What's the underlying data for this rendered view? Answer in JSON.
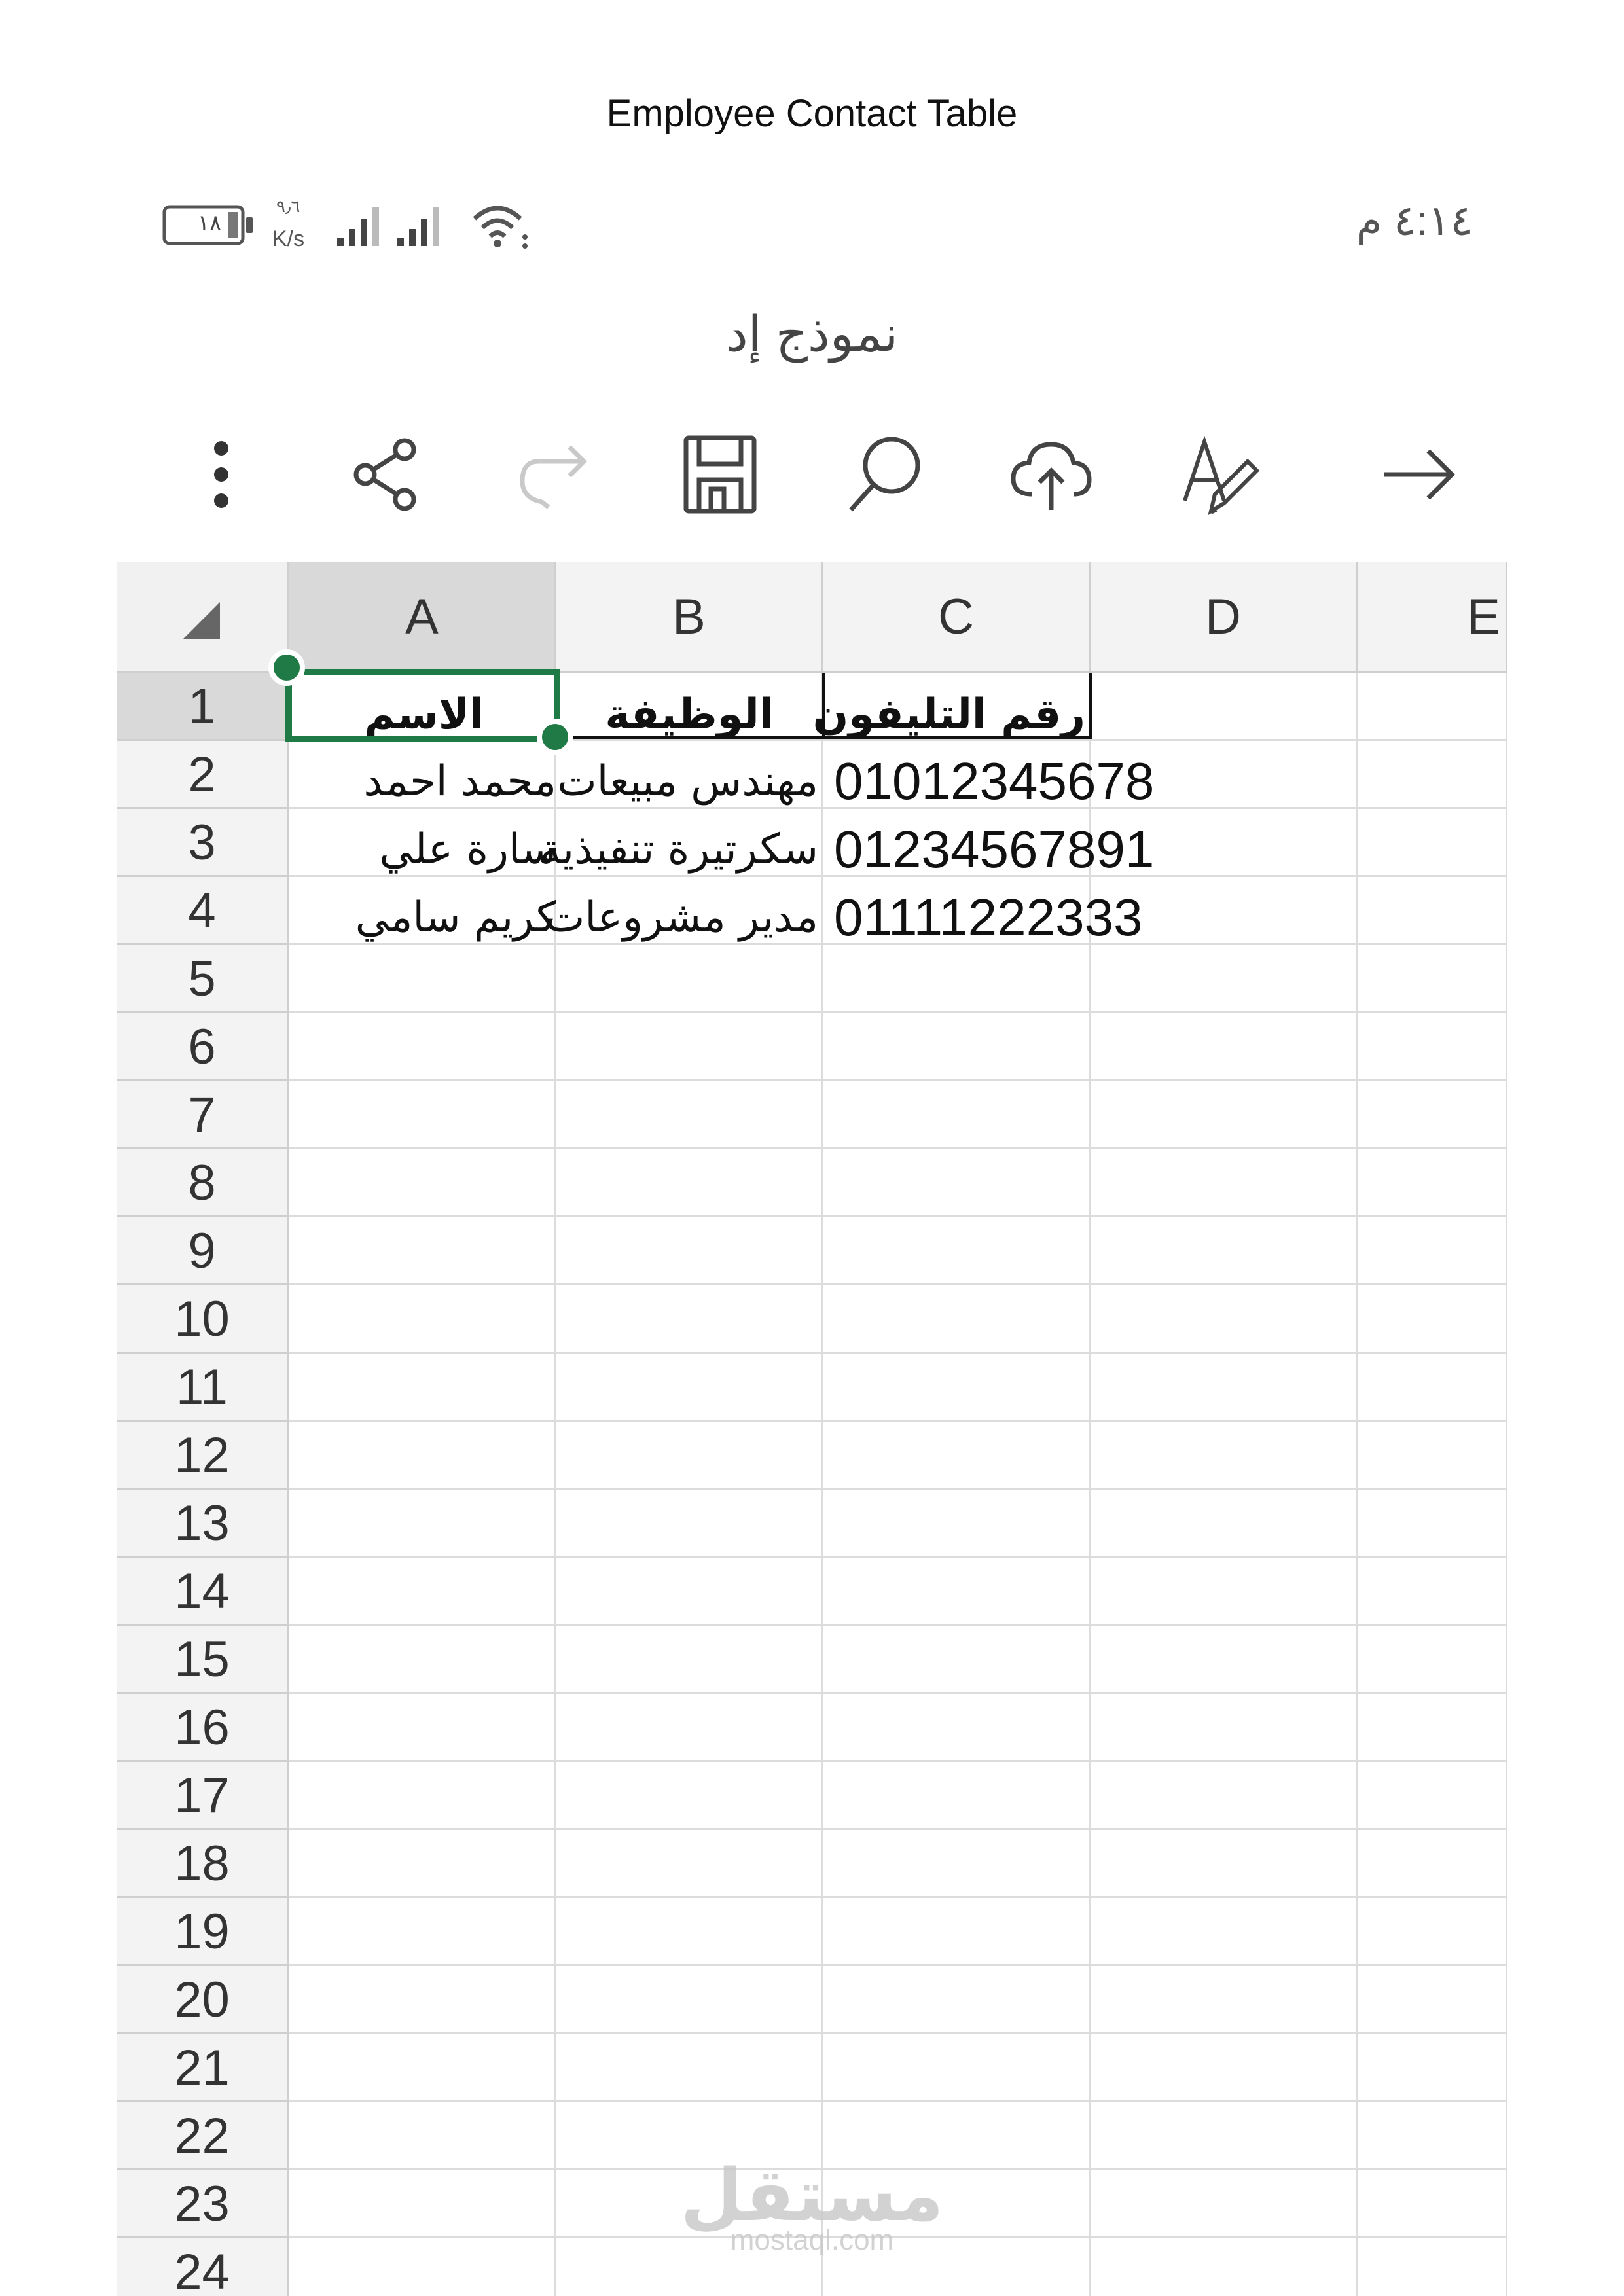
{
  "document_title": "Employee Contact Table",
  "status_bar": {
    "battery": "١٨",
    "speed_value": "٩٫٦",
    "speed_unit": "K/s",
    "time": "٤:١٤ م"
  },
  "workbook_name": "نموذج إد",
  "toolbar": {
    "items": [
      "more-icon",
      "share-icon",
      "redo-icon",
      "save-icon",
      "search-icon",
      "upload-icon",
      "format-icon",
      "arrow-right-icon"
    ]
  },
  "grid": {
    "columns": [
      "A",
      "B",
      "C",
      "D",
      "E"
    ],
    "rows": [
      "1",
      "2",
      "3",
      "4",
      "5",
      "6",
      "7",
      "8",
      "9",
      "10",
      "11",
      "12",
      "13",
      "14",
      "15",
      "16",
      "17",
      "18",
      "19",
      "20",
      "21",
      "22",
      "23",
      "24"
    ],
    "header_row": {
      "a": "الاسم",
      "b": "الوظيفة",
      "c": "رقم التليفون"
    },
    "data_rows": [
      {
        "a": "محمد احمد",
        "b": "مهندس مبيعات",
        "c": "01012345678"
      },
      {
        "a": "سارة علي",
        "b": "سكرتيرة تنفيذية",
        "c": "01234567891"
      },
      {
        "a": "كريم سامي",
        "b": "مدير مشروعات",
        "c": "01111222333"
      }
    ]
  },
  "watermark": {
    "arabic": "مستقل",
    "latin": "mostaql.com"
  },
  "colors": {
    "selection": "#1f7a45",
    "header_bg": "#f3f3f3",
    "gridline": "#dcdcdc"
  }
}
